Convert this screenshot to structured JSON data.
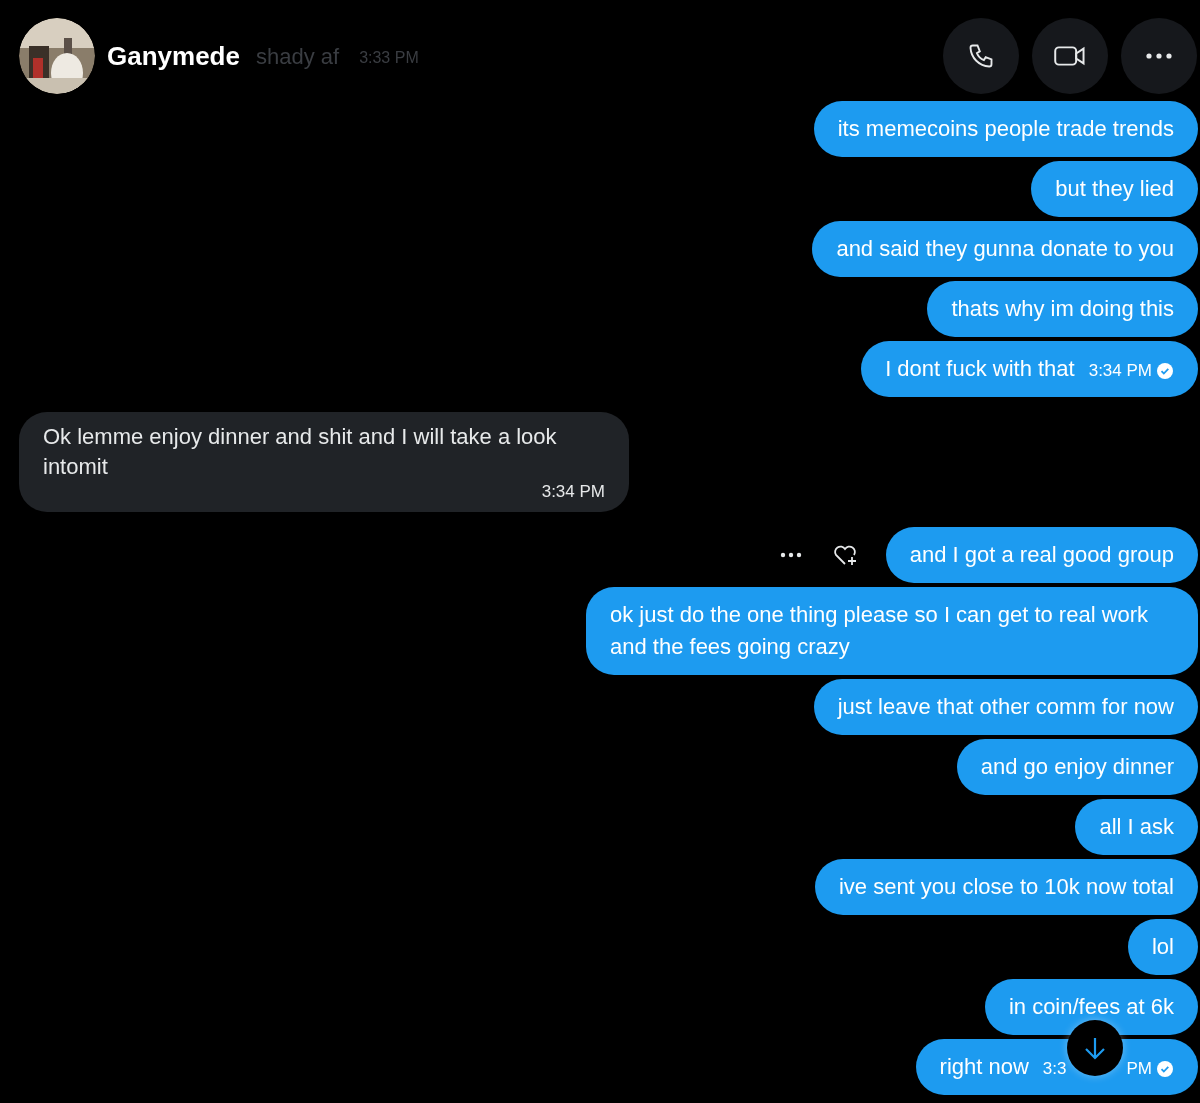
{
  "header": {
    "name": "Ganymede",
    "preview": "shady af",
    "preview_time": "3:33 PM"
  },
  "messages": [
    {
      "kind": "sent",
      "text": "its memecoins people trade trends"
    },
    {
      "kind": "sent",
      "text": "but they lied"
    },
    {
      "kind": "sent",
      "text": "and said they gunna donate to you"
    },
    {
      "kind": "sent",
      "text": "thats why im doing this"
    },
    {
      "kind": "sent",
      "text": "I dont fuck with that",
      "time": "3:34 PM",
      "seen": true
    },
    {
      "kind": "received",
      "text": "Ok lemme enjoy dinner and shit and I will take a look intomit",
      "time": "3:34 PM"
    },
    {
      "kind": "sent",
      "text": "and I got a real good group",
      "hovered": true
    },
    {
      "kind": "sent",
      "text": "ok just do the one thing please so I can get to real work and the fees going crazy"
    },
    {
      "kind": "sent",
      "text": "just leave that other comm for now"
    },
    {
      "kind": "sent",
      "text": "and go enjoy dinner"
    },
    {
      "kind": "sent",
      "text": "all I ask"
    },
    {
      "kind": "sent",
      "text": "ive sent you close to 10k now total"
    },
    {
      "kind": "sent",
      "text": "lol"
    },
    {
      "kind": "sent",
      "text": "in coin/fees at 6k"
    },
    {
      "kind": "sent",
      "text": "right now",
      "time": "3:3",
      "time_end": "PM",
      "seen": true
    }
  ]
}
